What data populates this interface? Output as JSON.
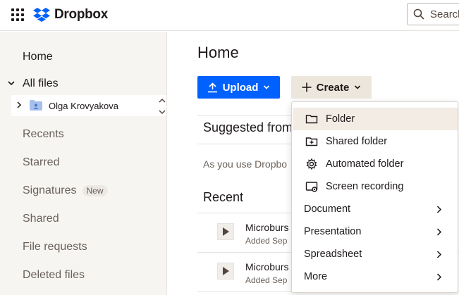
{
  "header": {
    "brand": "Dropbox",
    "search_placeholder": "Search"
  },
  "colors": {
    "accent": "#0061fe",
    "create_bg": "#ede6dc",
    "sidebar_bg": "#f7f5f2",
    "menu_highlight": "#f2ece4"
  },
  "sidebar": {
    "home": "Home",
    "all_files": "All files",
    "tree_folder": "Olga Krovyakova",
    "recents": "Recents",
    "starred": "Starred",
    "signatures": "Signatures",
    "signatures_badge": "New",
    "shared": "Shared",
    "file_requests": "File requests",
    "deleted_files": "Deleted files"
  },
  "main": {
    "title": "Home",
    "upload_label": "Upload",
    "create_label": "Create",
    "suggested_heading": "Suggested from",
    "suggested_text": "As you use Dropbo",
    "recent_heading": "Recent",
    "files": [
      {
        "name": "Microburs",
        "meta": "Added Sep"
      },
      {
        "name": "Microburs",
        "meta": "Added Sep"
      }
    ]
  },
  "create_menu": {
    "items": [
      {
        "label": "Folder",
        "icon": "folder-icon"
      },
      {
        "label": "Shared folder",
        "icon": "shared-folder-icon"
      },
      {
        "label": "Automated folder",
        "icon": "gear-icon"
      },
      {
        "label": "Screen recording",
        "icon": "screen-recording-icon"
      },
      {
        "label": "Document"
      },
      {
        "label": "Presentation"
      },
      {
        "label": "Spreadsheet"
      },
      {
        "label": "More"
      }
    ]
  }
}
